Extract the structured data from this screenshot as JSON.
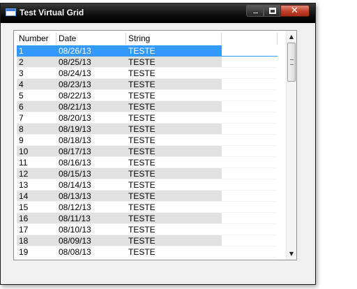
{
  "window": {
    "title": "Test Virtual Grid"
  },
  "grid": {
    "columns": [
      "Number",
      "Date",
      "String",
      ""
    ],
    "rows": [
      [
        "1",
        "08/26/13",
        "TESTE"
      ],
      [
        "2",
        "08/25/13",
        "TESTE"
      ],
      [
        "3",
        "08/24/13",
        "TESTE"
      ],
      [
        "4",
        "08/23/13",
        "TESTE"
      ],
      [
        "5",
        "08/22/13",
        "TESTE"
      ],
      [
        "6",
        "08/21/13",
        "TESTE"
      ],
      [
        "7",
        "08/20/13",
        "TESTE"
      ],
      [
        "8",
        "08/19/13",
        "TESTE"
      ],
      [
        "9",
        "08/18/13",
        "TESTE"
      ],
      [
        "10",
        "08/17/13",
        "TESTE"
      ],
      [
        "11",
        "08/16/13",
        "TESTE"
      ],
      [
        "12",
        "08/15/13",
        "TESTE"
      ],
      [
        "13",
        "08/14/13",
        "TESTE"
      ],
      [
        "14",
        "08/13/13",
        "TESTE"
      ],
      [
        "15",
        "08/12/13",
        "TESTE"
      ],
      [
        "16",
        "08/11/13",
        "TESTE"
      ],
      [
        "17",
        "08/10/13",
        "TESTE"
      ],
      [
        "18",
        "08/09/13",
        "TESTE"
      ],
      [
        "19",
        "08/08/13",
        "TESTE"
      ]
    ],
    "selected_row": 0
  },
  "scrollbar": {
    "up_arrow": "▲",
    "down_arrow": "▼"
  },
  "icons": {
    "window_icon": "app-window-icon",
    "minimize": "minimize-icon",
    "maximize": "maximize-icon",
    "close": "close-icon"
  },
  "colors": {
    "selection": "#3399ff",
    "alt_row": "#e1e1e1",
    "close_button": "#c0402a"
  }
}
